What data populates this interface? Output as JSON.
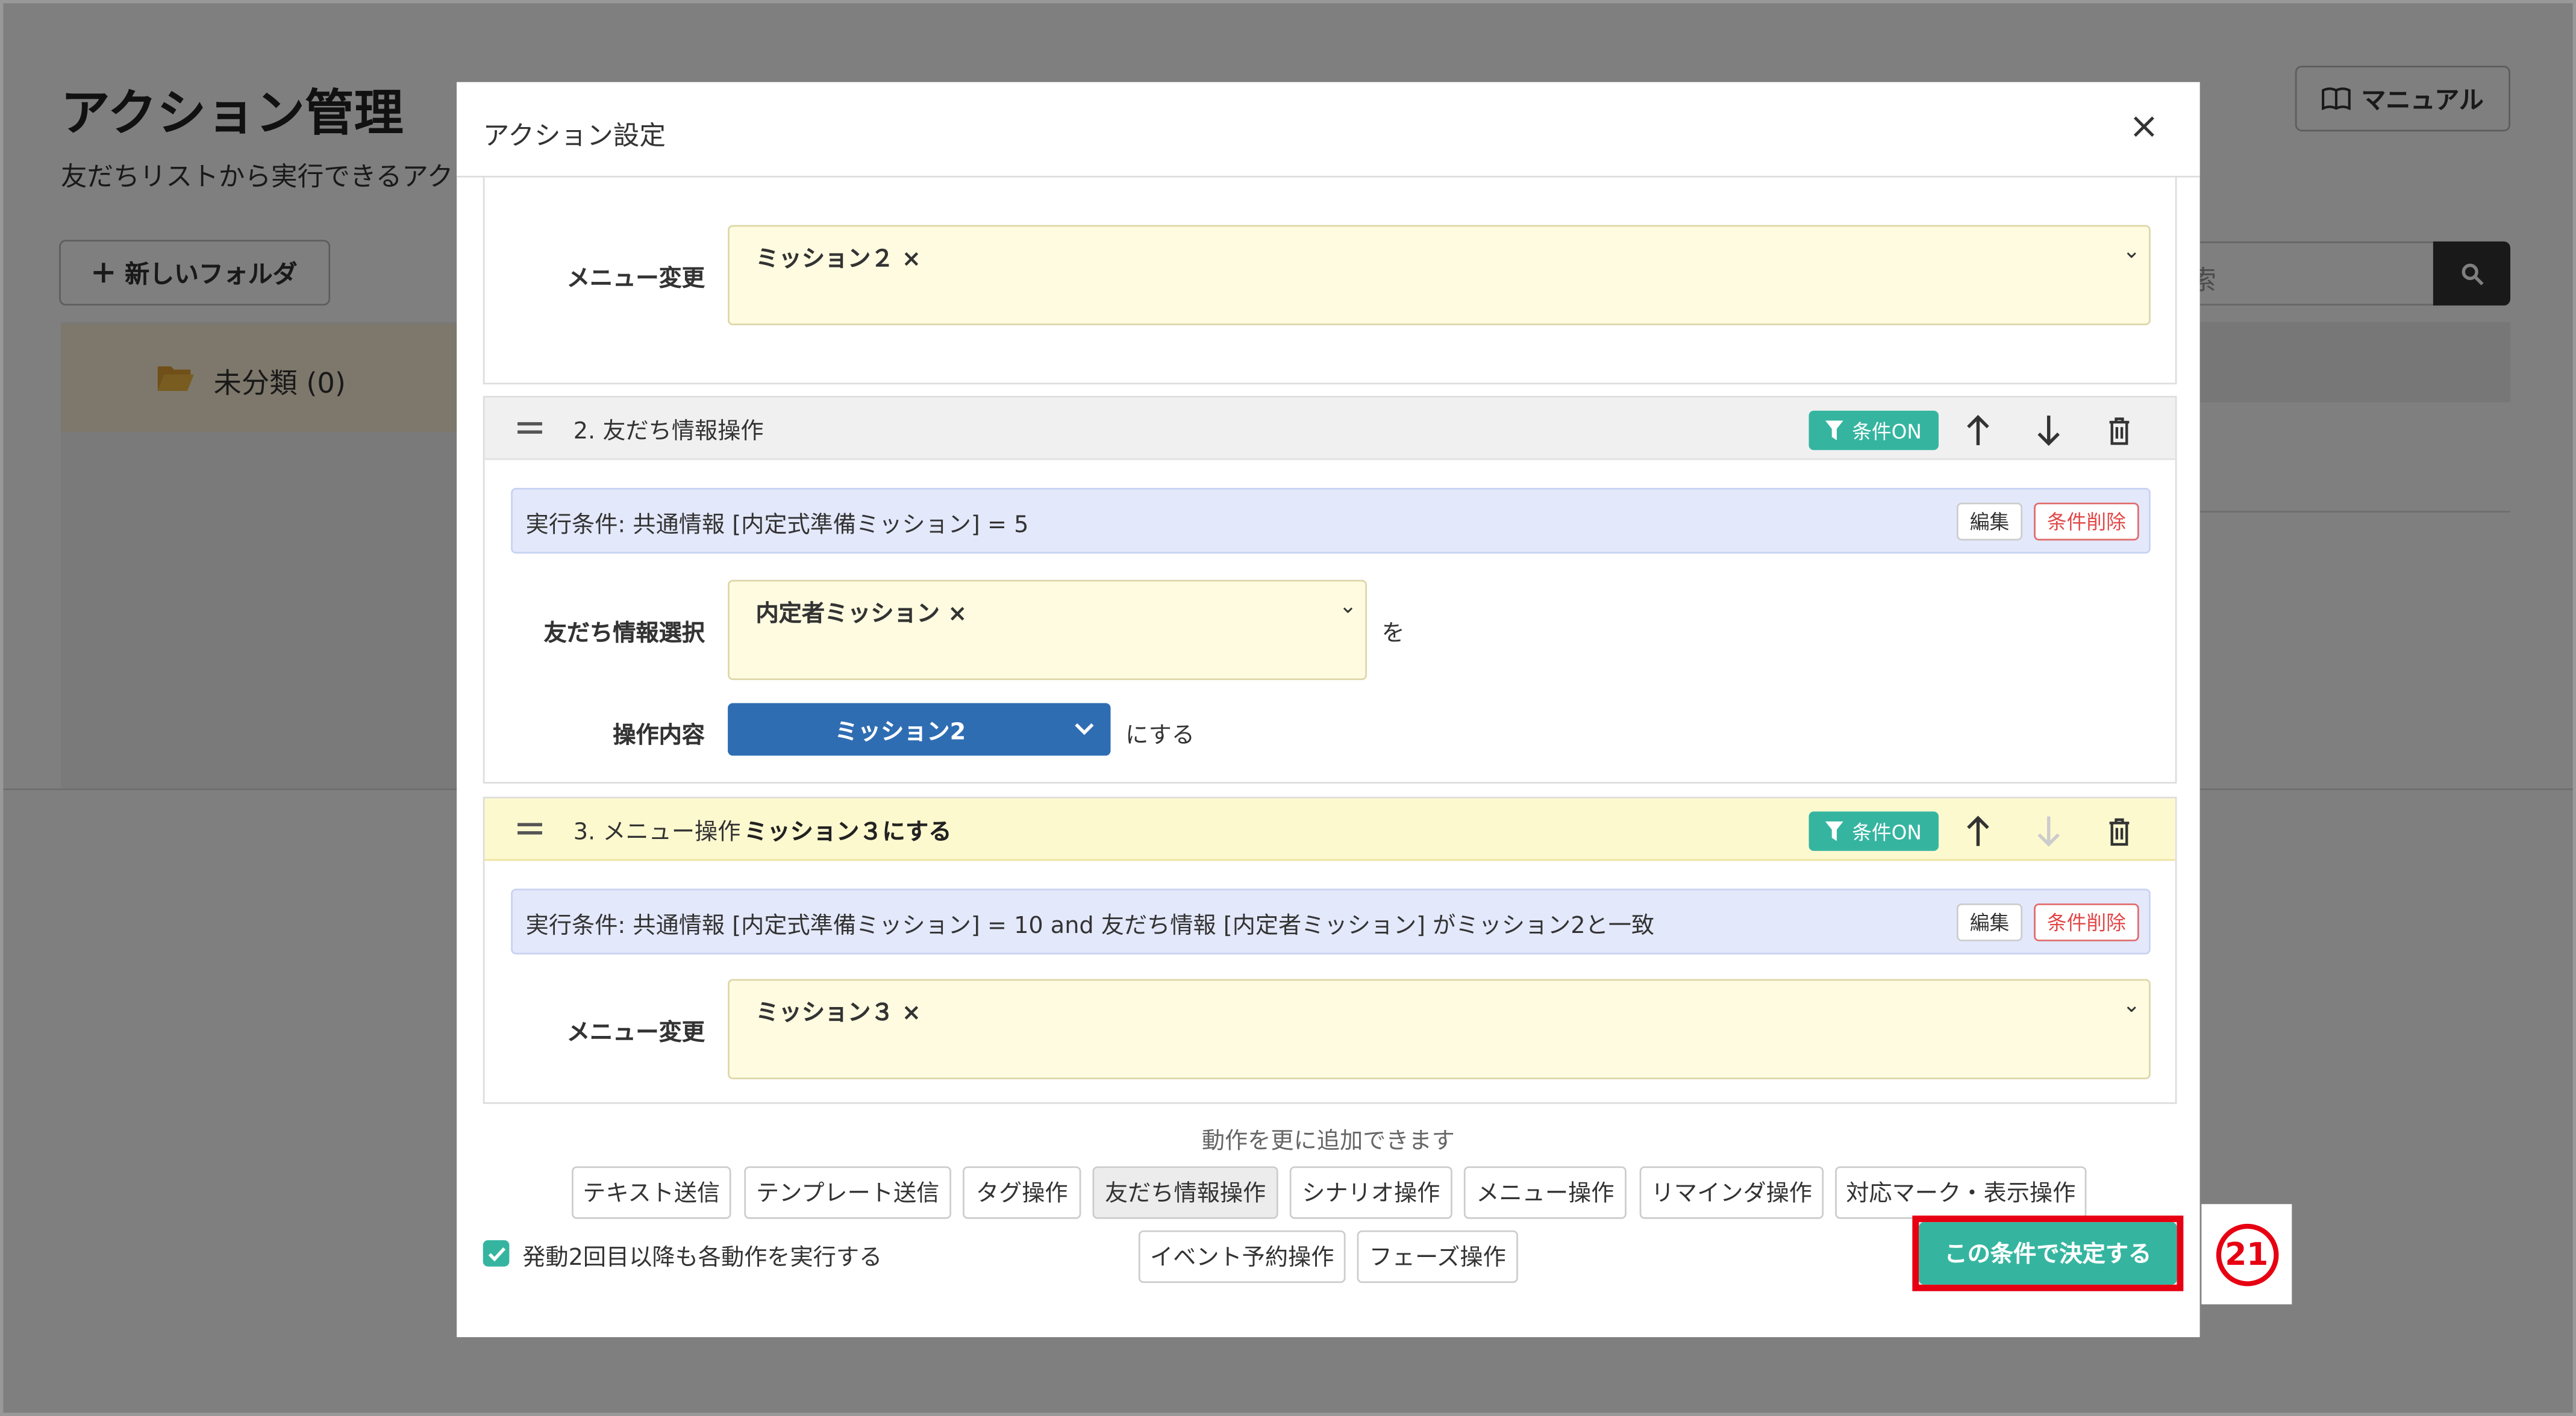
{
  "background": {
    "title": "アクション管理",
    "subtitle": "友だちリストから実行できるアク",
    "manual_button": "マニュアル",
    "new_folder_button": "新しいフォルダ",
    "folder_item": "未分類 (0)",
    "search_placeholder": "索"
  },
  "modal": {
    "title": "アクション設定",
    "close": "×",
    "top_card": {
      "field_label": "メニュー変更",
      "selected_tag": "ミッション２ ×",
      "caret": "⌄"
    },
    "card2": {
      "title": "2. 友だち情報操作",
      "condition_badge": "条件ON",
      "condition_text": "実行条件: 共通情報 [内定式準備ミッション] = 5",
      "edit_button": "編集",
      "delete_condition_button": "条件削除",
      "friend_info_label": "友だち情報選択",
      "friend_info_tag": "内定者ミッション ×",
      "friend_info_suffix": "を",
      "operation_label": "操作内容",
      "operation_value": "ミッション2",
      "operation_suffix": "にする"
    },
    "card3": {
      "title": "3. メニュー操作",
      "title_bold": "ミッション３にする",
      "condition_badge": "条件ON",
      "condition_text": "実行条件: 共通情報 [内定式準備ミッション] = 10 and 友だち情報 [内定者ミッション] がミッション2と一致",
      "edit_button": "編集",
      "delete_condition_button": "条件削除",
      "field_label": "メニュー変更",
      "selected_tag": "ミッション３ ×"
    },
    "add_actions_label": "動作を更に追加できます",
    "add_actions": [
      "テキスト送信",
      "テンプレート送信",
      "タグ操作",
      "友だち情報操作",
      "シナリオ操作",
      "メニュー操作",
      "リマインダ操作",
      "対応マーク・表示操作",
      "イベント予約操作",
      "フェーズ操作"
    ],
    "checkbox_label": "発動2回目以降も各動作を実行する",
    "checkbox_checked": true,
    "submit_button": "この条件で決定する"
  },
  "annotation": {
    "step_number": "21"
  },
  "colors": {
    "accent_teal": "#35b5a0",
    "select_blue": "#2f6db3",
    "highlight_red": "#e60012",
    "condition_bar": "#e3e8fb",
    "field_yellow": "#fefbe0"
  }
}
